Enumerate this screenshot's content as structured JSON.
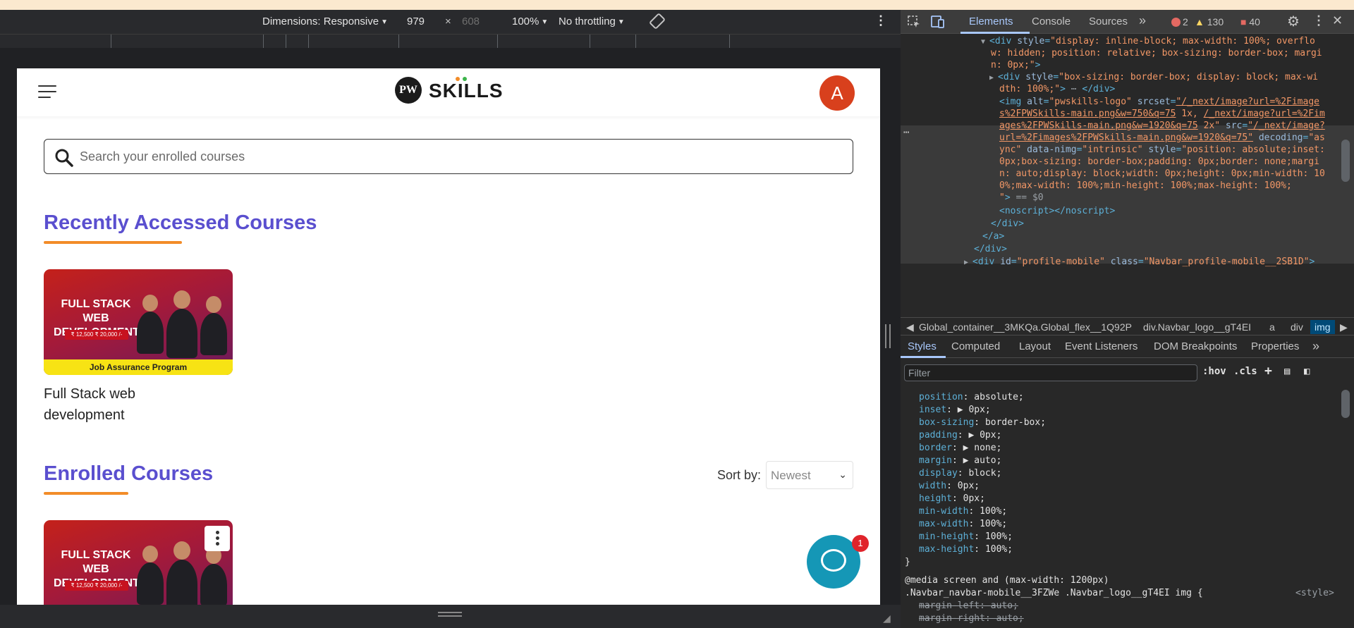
{
  "device_toolbar": {
    "dimensions_label": "Dimensions: Responsive",
    "width": "979",
    "times": "×",
    "height": "608",
    "zoom": "100%",
    "throttling": "No throttling"
  },
  "page": {
    "logo_text": "SKILLS",
    "logo_mark": "PW",
    "avatar_letter": "A",
    "search_placeholder": "Search your enrolled courses",
    "recent_heading": "Recently Accessed Courses",
    "course_card": {
      "banner_line1": "FULL STACK",
      "banner_line2": "WEB DEVELOPMENT",
      "price": "₹ 12,500 ₹ 20,000 /-",
      "band": "Job Assurance Program"
    },
    "recent_course_title": "Full Stack web development",
    "enrolled_heading": "Enrolled Courses",
    "sort_label": "Sort by:",
    "sort_value": "Newest",
    "chat_badge": "1"
  },
  "devtools": {
    "tabs": [
      "Elements",
      "Console",
      "Sources"
    ],
    "more": "»",
    "errors": "2",
    "warnings": "130",
    "issues": "40",
    "code_lines": [
      {
        "parts": [
          [
            "tag",
            "<div "
          ],
          [
            "attr",
            "style"
          ],
          [
            "tag",
            "="
          ],
          [
            "val",
            "\"display: inline-block; max-width: 100%; overflo"
          ]
        ]
      },
      {
        "parts": [
          [
            "val",
            "w: hidden; position: relative; box-sizing: border-box; margi"
          ]
        ]
      },
      {
        "parts": [
          [
            "val",
            "n: 0px;\""
          ],
          [
            "tag",
            ">"
          ]
        ]
      },
      {
        "parts": [
          [
            "tag",
            "<div "
          ],
          [
            "attr",
            "style"
          ],
          [
            "tag",
            "="
          ],
          [
            "val",
            "\"box-sizing: border-box; display: block; max-wi"
          ]
        ]
      },
      {
        "parts": [
          [
            "val",
            "dth: 100%;\""
          ],
          [
            "tag",
            ">"
          ],
          [
            "dim",
            " ⋯ "
          ],
          [
            "tag",
            "</div>"
          ]
        ]
      },
      {
        "parts": [
          [
            "tag",
            "<img "
          ],
          [
            "attr",
            "alt"
          ],
          [
            "tag",
            "="
          ],
          [
            "val",
            "\"pwskills-logo\" "
          ],
          [
            "attr",
            "srcset"
          ],
          [
            "tag",
            "="
          ],
          [
            "link",
            "\"/_next/image?url=%2Fimage"
          ]
        ]
      },
      {
        "parts": [
          [
            "link",
            "s%2FPWSkills-main.png&w=750&q=75"
          ],
          [
            "val",
            " 1x, "
          ],
          [
            "link",
            "/_next/image?url=%2Fim"
          ]
        ]
      },
      {
        "parts": [
          [
            "link",
            "ages%2FPWSkills-main.png&w=1920&q=75"
          ],
          [
            "val",
            " 2x\" "
          ],
          [
            "attr",
            "src"
          ],
          [
            "tag",
            "="
          ],
          [
            "link",
            "\"/_next/image?"
          ]
        ]
      },
      {
        "parts": [
          [
            "link",
            "url=%2Fimages%2FPWSkills-main.png&w=1920&q=75\""
          ],
          [
            "attr",
            " decoding"
          ],
          [
            "tag",
            "="
          ],
          [
            "val",
            "\"as"
          ]
        ]
      },
      {
        "parts": [
          [
            "val",
            "ync\" "
          ],
          [
            "attr",
            "data-nimg"
          ],
          [
            "tag",
            "="
          ],
          [
            "val",
            "\"intrinsic\" "
          ],
          [
            "attr",
            "style"
          ],
          [
            "tag",
            "="
          ],
          [
            "val",
            "\"position: absolute;inset:"
          ]
        ]
      },
      {
        "parts": [
          [
            "val",
            "0px;box-sizing: border-box;padding: 0px;border: none;margi"
          ]
        ]
      },
      {
        "parts": [
          [
            "val",
            "n: auto;display: block;width: 0px;height: 0px;min-width: 10"
          ]
        ]
      },
      {
        "parts": [
          [
            "val",
            "0%;max-width: 100%;min-height: 100%;max-height: 100%;"
          ]
        ]
      },
      {
        "parts": [
          [
            "val",
            "\""
          ],
          [
            "tag",
            ">"
          ],
          [
            "dim",
            " == $0"
          ]
        ]
      },
      {
        "parts": [
          [
            "tag",
            "<noscript></noscript>"
          ]
        ]
      },
      {
        "parts": [
          [
            "tag",
            "</div>"
          ]
        ]
      },
      {
        "parts": [
          [
            "tag",
            "</a>"
          ]
        ]
      },
      {
        "parts": [
          [
            "tag",
            "</div>"
          ]
        ]
      },
      {
        "parts": [
          [
            "tag",
            "<div "
          ],
          [
            "attr",
            "id"
          ],
          [
            "tag",
            "="
          ],
          [
            "val",
            "\"profile-mobile\" "
          ],
          [
            "attr",
            "class"
          ],
          [
            "tag",
            "="
          ],
          [
            "val",
            "\"Navbar_profile-mobile__2SB1D\""
          ],
          [
            "tag",
            ">"
          ]
        ]
      }
    ],
    "breadcrumbs": [
      "Global_container__3MKQa.Global_flex__1Q92P",
      "div.Navbar_logo__gT4EI",
      "a",
      "div",
      "img"
    ],
    "styles_tabs": [
      "Styles",
      "Computed",
      "Layout",
      "Event Listeners",
      "DOM Breakpoints",
      "Properties"
    ],
    "filter_placeholder": "Filter",
    "hov": ":hov",
    "cls": ".cls",
    "css_props": [
      [
        "position",
        "absolute;"
      ],
      [
        "inset",
        "▶ 0px;"
      ],
      [
        "box-sizing",
        "border-box;"
      ],
      [
        "padding",
        "▶ 0px;"
      ],
      [
        "border",
        "▶ none;"
      ],
      [
        "margin",
        "▶ auto;"
      ],
      [
        "display",
        "block;"
      ],
      [
        "width",
        "0px;"
      ],
      [
        "height",
        "0px;"
      ],
      [
        "min-width",
        "100%;"
      ],
      [
        "max-width",
        "100%;"
      ],
      [
        "min-height",
        "100%;"
      ],
      [
        "max-height",
        "100%;"
      ]
    ],
    "closing_brace": "}",
    "media_rule": "@media screen and (max-width: 1200px)",
    "selector": ".Navbar_navbar-mobile__3FZWe .Navbar_logo__gT4EI img {",
    "style_source": "<style>",
    "struck_props": [
      [
        "margin-left",
        "auto;"
      ],
      [
        "margin-right",
        "auto;"
      ]
    ]
  },
  "colors": {
    "heading": "#5a4fcf",
    "underline": "#f28c28",
    "avatar": "#d8401d",
    "chat": "#1597b6",
    "accent": "#a8c7fa"
  }
}
